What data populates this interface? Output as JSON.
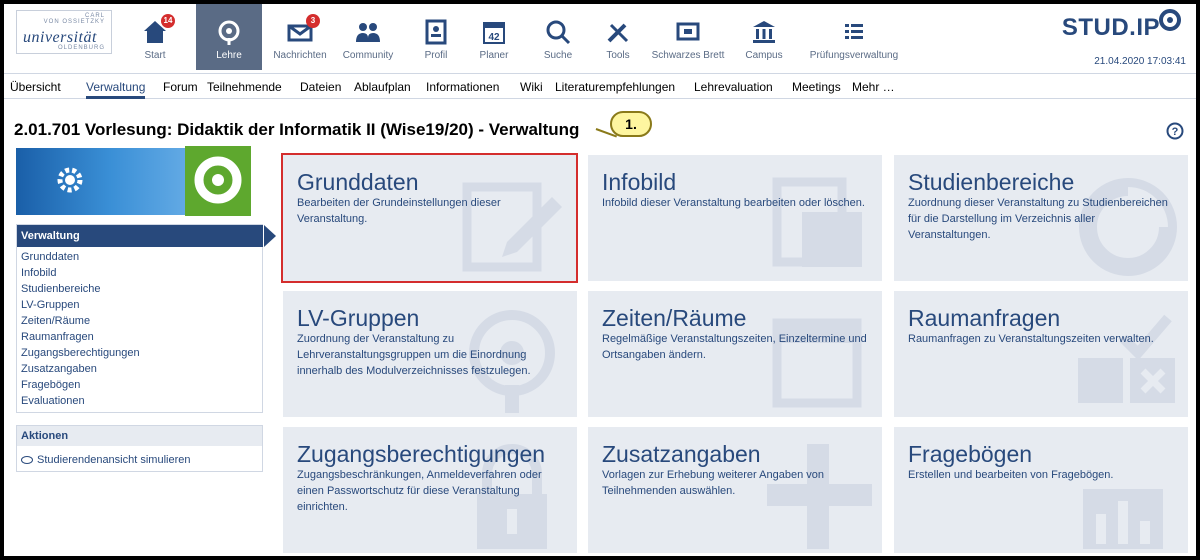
{
  "logo": {
    "line1": "CARL",
    "line2": "VON OSSIETZKY",
    "line3": "universität",
    "line4": "OLDENBURG"
  },
  "nav": [
    {
      "label": "Start",
      "badge": "14",
      "icon": "home-icon"
    },
    {
      "label": "Lehre",
      "badge": "",
      "icon": "seminar-icon"
    },
    {
      "label": "Nachrichten",
      "badge": "3",
      "icon": "mail-icon"
    },
    {
      "label": "Community",
      "badge": "",
      "icon": "community-icon"
    },
    {
      "label": "Profil",
      "badge": "",
      "icon": "profile-icon"
    },
    {
      "label": "Planer",
      "badge": "",
      "icon": "calendar-icon",
      "calendar_day": "42"
    },
    {
      "label": "Suche",
      "badge": "",
      "icon": "search-icon"
    },
    {
      "label": "Tools",
      "badge": "",
      "icon": "tools-icon"
    },
    {
      "label": "Schwarzes Brett",
      "badge": "",
      "icon": "board-icon"
    },
    {
      "label": "Campus",
      "badge": "",
      "icon": "campus-icon"
    },
    {
      "label": "Prüfungsverwaltung",
      "badge": "",
      "icon": "list-icon"
    }
  ],
  "brand": "STUD.IP",
  "datetime": "21.04.2020 17:03:41",
  "tabs": [
    "Übersicht",
    "Verwaltung",
    "Forum",
    "Teilnehmende",
    "Dateien",
    "Ablaufplan",
    "Informationen",
    "Wiki",
    "Literaturempfehlungen",
    "Lehrevaluation",
    "Meetings",
    "Mehr …"
  ],
  "active_tab": "Verwaltung",
  "page_title": "2.01.701 Vorlesung: Didaktik der Informatik II (Wise19/20) - Verwaltung",
  "callout": "1.",
  "sidebar": {
    "nav_title": "Verwaltung",
    "links": [
      "Grunddaten",
      "Infobild",
      "Studienbereiche",
      "LV-Gruppen",
      "Zeiten/Räume",
      "Raumanfragen",
      "Zugangsberechtigungen",
      "Zusatzangaben",
      "Fragebögen",
      "Evaluationen"
    ],
    "actions_title": "Aktionen",
    "action": "Studierendenansicht simulieren"
  },
  "tiles": [
    {
      "title": "Grunddaten",
      "desc": "Bearbeiten der Grundeinstellungen dieser Veranstaltung.",
      "icon": "edit-icon"
    },
    {
      "title": "Infobild",
      "desc": "Infobild dieser Veranstaltung bearbeiten oder löschen.",
      "icon": "image-icon"
    },
    {
      "title": "Studienbereiche",
      "desc": "Zuordnung dieser Veranstaltung zu Studienbereichen für die Darstellung im Verzeichnis aller Veranstaltungen.",
      "icon": "pie-icon"
    },
    {
      "title": "LV-Gruppen",
      "desc": "Zuordnung der Veranstaltung zu Lehrveranstaltungsgruppen um die Einordnung innerhalb des Modulverzeichnisses festzulegen.",
      "icon": "module-icon"
    },
    {
      "title": "Zeiten/Räume",
      "desc": "Regelmäßige Veranstaltungszeiten, Einzeltermine und Ortsangaben ändern.",
      "icon": "calendar-bg-icon"
    },
    {
      "title": "Raumanfragen",
      "desc": "Raumanfragen zu Veranstaltungszeiten verwalten.",
      "icon": "room-request-icon"
    },
    {
      "title": "Zugangsberechtigungen",
      "desc": "Zugangsbeschränkungen, Anmeldeverfahren oder einen Passwortschutz für diese Veranstaltung einrichten.",
      "icon": "lock-icon"
    },
    {
      "title": "Zusatzangaben",
      "desc": "Vorlagen zur Erhebung weiterer Angaben von Teilnehmenden auswählen.",
      "icon": "plus-icon"
    },
    {
      "title": "Fragebögen",
      "desc": "Erstellen und bearbeiten von Fragebögen.",
      "icon": "bar-chart-icon"
    }
  ],
  "colors": {
    "primary": "#28497c",
    "tile_bg": "#e7ebf1",
    "highlight": "#d42d2d",
    "badge": "#d42d2d",
    "logo_green": "#5ea82e"
  }
}
